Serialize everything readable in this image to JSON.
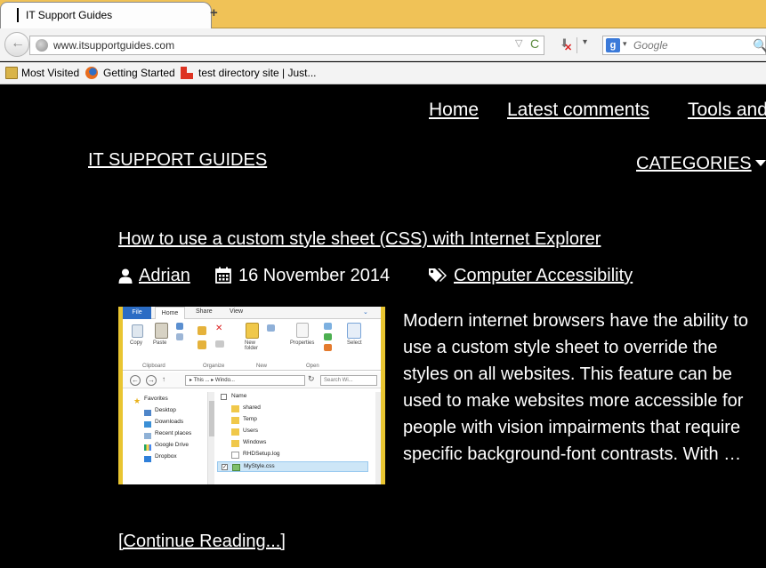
{
  "browser": {
    "tab_title": "IT Support Guides",
    "new_tab_symbol": "+",
    "back_symbol": "←",
    "url": "www.itsupportguides.com",
    "url_dropdown_symbol": "▽",
    "reload_symbol": "C",
    "download_symbol": "⬇",
    "download_cancel_symbol": "✕",
    "dropdown_symbol": "▾",
    "search_engine_letter": "g",
    "search_placeholder": "Google",
    "search_go_symbol": "🔍",
    "bookmarks": [
      {
        "label": "Most Visited",
        "icon": "folder-icon"
      },
      {
        "label": "Getting Started",
        "icon": "firefox-icon"
      },
      {
        "label": "test directory site | Just...",
        "icon": "site-icon"
      }
    ]
  },
  "site": {
    "nav": [
      "Home",
      "Latest comments",
      "Tools and"
    ],
    "title": "IT SUPPORT GUIDES",
    "categories_label": "CATEGORIES"
  },
  "post": {
    "title": "How to use a custom style sheet (CSS) with Internet Explorer",
    "author": "Adrian",
    "date": "16 November 2014",
    "category": "Computer Accessibility",
    "excerpt": "Modern internet browsers have the ability to use a custom style sheet to override the styles on all websites. This feature can be used to make websites more accessible for people with vision impairments that require specific background-font contrasts. With …",
    "continue_label": "[Continue Reading...]"
  },
  "thumbnail": {
    "ribbon_tabs": [
      "File",
      "Home",
      "Share",
      "View"
    ],
    "ribbon_labels": [
      "Copy",
      "Paste",
      "New folder",
      "Properties",
      "Select"
    ],
    "ribbon_groups": [
      "Clipboard",
      "Organize",
      "New",
      "Open"
    ],
    "address_text": "▸ This ... ▸ Windo...",
    "search_placeholder": "Search Wi...",
    "tree_items": [
      "Favorites",
      "Desktop",
      "Downloads",
      "Recent places",
      "Google Drive",
      "Dropbox"
    ],
    "files_header": "Name",
    "files": [
      "shared",
      "Temp",
      "Users",
      "Windows",
      "RHDSetup.log",
      "MyStyle.css"
    ],
    "selected_file": "MyStyle.css"
  },
  "colors": {
    "tabbar": "#f0c257",
    "page_bg": "#000000",
    "page_text": "#ffffff",
    "thumb_frame": "#e9c531",
    "ribbon_file_tab": "#2b6cc4"
  }
}
